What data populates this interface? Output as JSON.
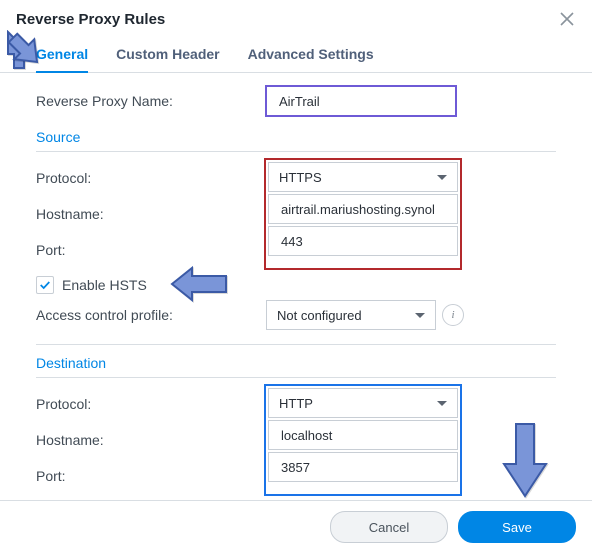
{
  "dialog": {
    "title": "Reverse Proxy Rules"
  },
  "tabs": {
    "general": "General",
    "custom_header": "Custom Header",
    "advanced": "Advanced Settings"
  },
  "labels": {
    "name": "Reverse Proxy Name:",
    "protocol": "Protocol:",
    "hostname": "Hostname:",
    "port": "Port:",
    "enable_hsts": "Enable HSTS",
    "acp": "Access control profile:"
  },
  "sections": {
    "source": "Source",
    "destination": "Destination"
  },
  "values": {
    "name": "AirTrail",
    "src_protocol": "HTTPS",
    "src_hostname": "airtrail.mariushosting.synol",
    "src_port": "443",
    "acp": "Not configured",
    "dst_protocol": "HTTP",
    "dst_hostname": "localhost",
    "dst_port": "3857"
  },
  "buttons": {
    "cancel": "Cancel",
    "save": "Save"
  },
  "icons": {
    "close": "close-icon",
    "chevron": "chevron-down-icon",
    "info": "info-icon",
    "check": "check-icon"
  }
}
